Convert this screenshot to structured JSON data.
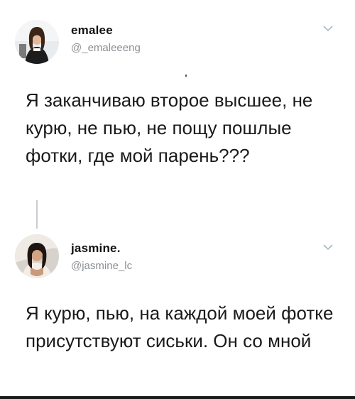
{
  "tweets": [
    {
      "display_name": "emalee",
      "handle": "@_emaleeeng",
      "text": "Я заканчиваю второе высшее, не курю, не пью, не пощу пошлые фотки, где мой парень???",
      "avatar_icon": "avatar-photo-woman"
    },
    {
      "display_name": "jasmine.",
      "handle": "@jasmine_lc",
      "text": "Я курю, пью, на каждой моей фотке присутствуют сиськи. Он со мной",
      "avatar_icon": "avatar-photo-woman"
    }
  ],
  "icons": {
    "menu": "chevron-down-icon"
  },
  "colors": {
    "name": "#111111",
    "handle": "#8a8f94",
    "thread_line": "#c9cdd1",
    "chevron": "#aab8c2"
  }
}
